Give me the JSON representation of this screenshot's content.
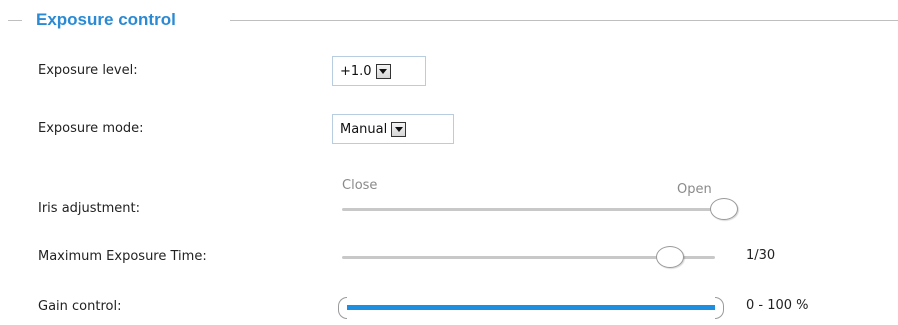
{
  "section": {
    "title": "Exposure control"
  },
  "exposure_level": {
    "label": "Exposure level:",
    "selected": "+1.0"
  },
  "exposure_mode": {
    "label": "Exposure mode:",
    "selected": "Manual"
  },
  "iris": {
    "label": "Iris adjustment:",
    "min_label": "Close",
    "max_label": "Open",
    "level": 1.0
  },
  "max_exposure_time": {
    "label": "Maximum Exposure Time:",
    "value": "1/30",
    "level": 0.88
  },
  "gain": {
    "label": "Gain control:",
    "value": "0 - 100 %",
    "range_min": 0,
    "range_max": 100
  },
  "colors": {
    "accent": "#2a8ad4",
    "slider_fill": "#1d8ee0",
    "track": "#c8c8c8"
  }
}
